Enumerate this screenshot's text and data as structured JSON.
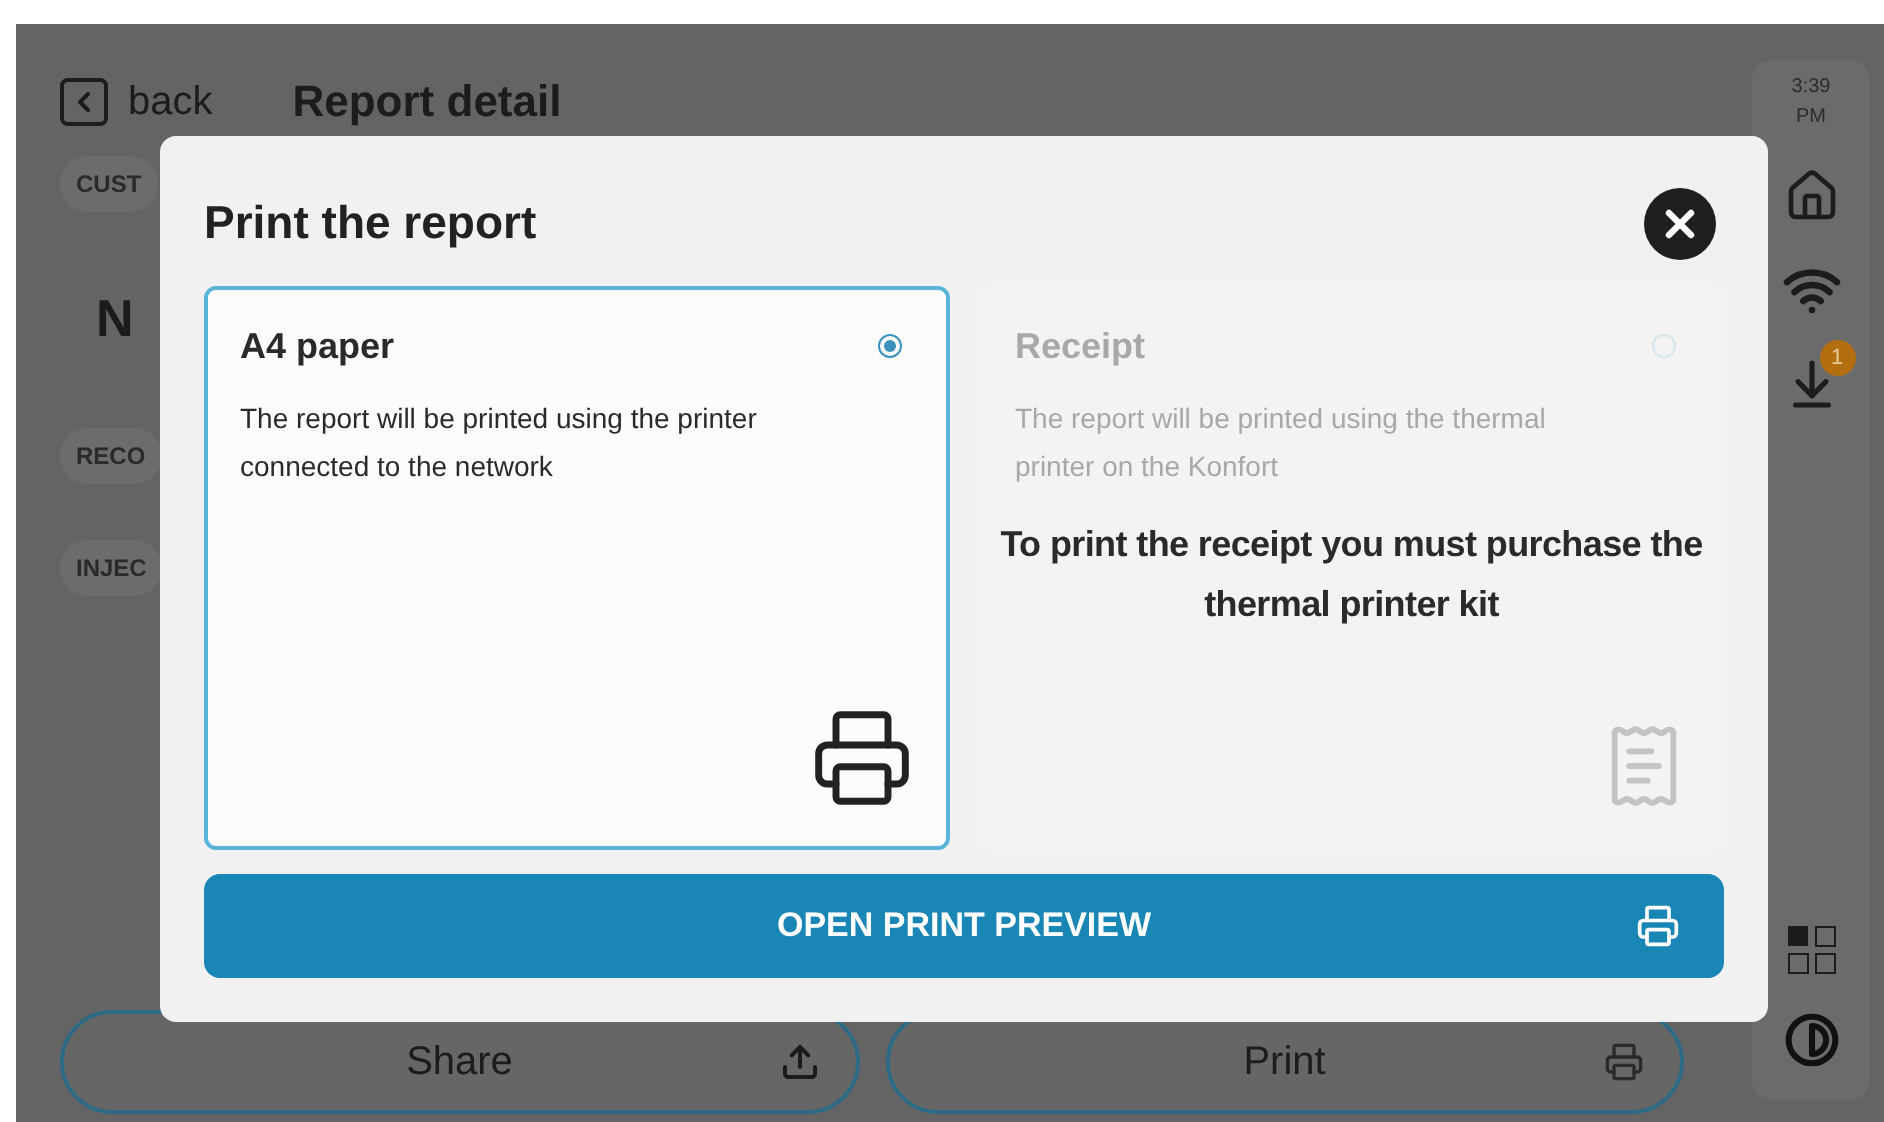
{
  "header": {
    "back_label": "back",
    "title": "Report detail"
  },
  "background_labels": [
    {
      "kind": "chip",
      "text": "CUST"
    },
    {
      "kind": "heading",
      "text": "N"
    },
    {
      "kind": "chip",
      "text": "RECO"
    },
    {
      "kind": "chip",
      "text": "INJEC"
    }
  ],
  "actions": [
    {
      "label": "Share"
    },
    {
      "label": "Print"
    }
  ],
  "status_sidebar": {
    "time": "3:39",
    "period": "PM",
    "download_badge": "1"
  },
  "dialog": {
    "title": "Print the report",
    "options": [
      {
        "title": "A4 paper",
        "description": "The report will be printed using the printer connected to the network",
        "selected": true,
        "disabled": false
      },
      {
        "title": "Receipt",
        "description": "The report will be printed using the thermal printer on the Konfort",
        "selected": false,
        "disabled": true
      }
    ],
    "notice": "To print the receipt you must purchase the thermal printer kit",
    "primary_button": "OPEN PRINT PREVIEW"
  }
}
